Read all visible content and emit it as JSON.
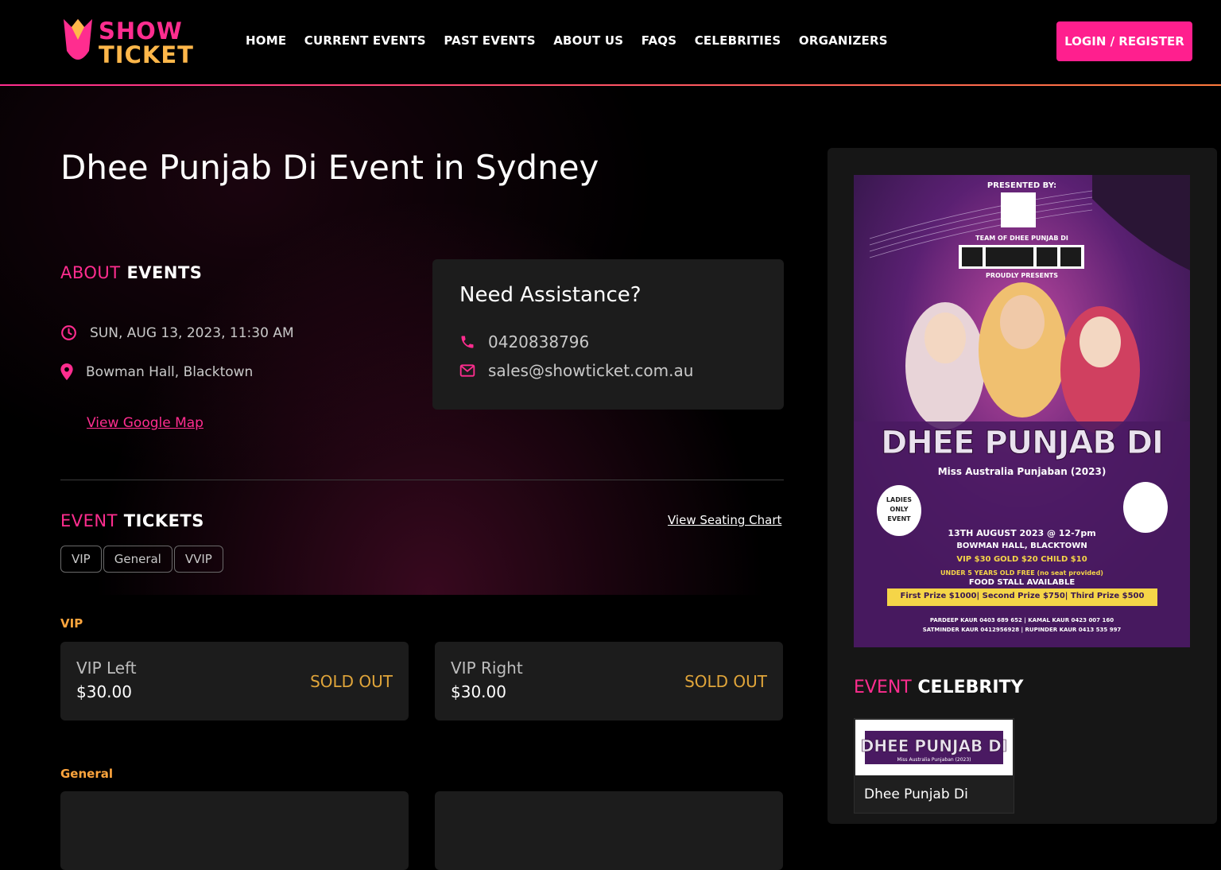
{
  "brand": {
    "line1": "SHOW",
    "line2": "TICKET",
    "colors": {
      "accent": "#ff1f8e",
      "gold": "#ffa53d"
    }
  },
  "nav": [
    "HOME",
    "CURRENT EVENTS",
    "PAST EVENTS",
    "ABOUT US",
    "FAQS",
    "CELEBRITIES",
    "ORGANIZERS"
  ],
  "login_label": "LOGIN / REGISTER",
  "event": {
    "title": "Dhee Punjab Di Event in Sydney",
    "about_accent": "ABOUT",
    "about_rest": " EVENTS",
    "datetime": "SUN, AUG 13, 2023, 11:30 AM",
    "venue": "Bowman Hall, Blacktown",
    "map_link": "View Google Map"
  },
  "assist": {
    "title": "Need Assistance?",
    "phone": "0420838796",
    "email": "sales@showticket.com.au"
  },
  "tickets": {
    "heading_accent": "EVENT",
    "heading_rest": " TICKETS",
    "seating_link": "View Seating Chart",
    "tabs": [
      "VIP",
      "General",
      "VVIP"
    ],
    "categories": [
      {
        "name": "VIP",
        "items": [
          {
            "name": "VIP Left",
            "price": "$30.00",
            "status": "SOLD OUT"
          },
          {
            "name": "VIP Right",
            "price": "$30.00",
            "status": "SOLD OUT"
          }
        ]
      },
      {
        "name": "General",
        "items": []
      }
    ]
  },
  "poster": {
    "presented_by": "PRESENTED BY:",
    "team": "TEAM OF DHEE PUNJAB DI",
    "proudly": "PROUDLY PRESENTS",
    "title": "DHEE PUNJAB DI",
    "subtitle": "Miss Australia Punjaban (2023)",
    "badge": "LADIES ONLY EVENT",
    "date": "13TH AUGUST 2023 @ 12-7pm",
    "venue": "BOWMAN HALL, BLACKTOWN",
    "prices": "VIP $30  GOLD $20  CHILD $10",
    "free": "UNDER 5 YEARS OLD FREE (no seat provided)",
    "food": "FOOD STALL AVAILABLE",
    "prizes": "First Prize $1000| Second Prize $750| Third Prize $500",
    "contact1": "PARDEEP KAUR 0403 689 652 | KAMAL KAUR 0423 007 160",
    "contact2": "SATMINDER KAUR 0412956928 | RUPINDER KAUR 0413 535 997"
  },
  "celebrity": {
    "heading_accent": "EVENT",
    "heading_rest": " CELEBRITY",
    "name": "Dhee Punjab Di"
  }
}
